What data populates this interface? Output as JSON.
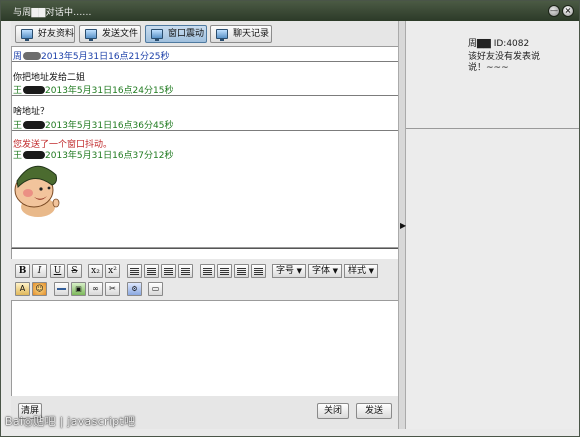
{
  "window": {
    "title": "与周▇▇对话中......",
    "minimize_glyph": "—",
    "close_glyph": "×"
  },
  "tabs": [
    {
      "label": "好友资料",
      "icon": "monitor-icon"
    },
    {
      "label": "发送文件",
      "icon": "monitor-icon"
    },
    {
      "label": "窗口震动",
      "icon": "monitor-icon",
      "active": true
    },
    {
      "label": "聊天记录",
      "icon": "monitor-icon"
    }
  ],
  "messages": [
    {
      "sender_prefix": "周",
      "timestamp": "2013年5月31日16点21分25秒",
      "text": "你把地址发给二姐"
    },
    {
      "sender_prefix": "王",
      "timestamp": "2013年5月31日16点24分15秒",
      "text": "啥地址？"
    },
    {
      "sender_prefix": "王",
      "timestamp": "2013年5月31日16点36分45秒",
      "text": "您发送了一个窗口抖动。"
    },
    {
      "sender_prefix": "王",
      "timestamp": "2013年5月31日16点37分12秒",
      "text": ""
    }
  ],
  "format_toolbar": {
    "bold": "B",
    "italic": "I",
    "underline": "U",
    "strike": "S",
    "subscript": "x₂",
    "superscript": "x²",
    "dropdowns": [
      "字号",
      "字体",
      "样式"
    ]
  },
  "buttons": {
    "clear": "清屏",
    "close": "关闭",
    "send": "发送"
  },
  "friend": {
    "name": "周▇▇",
    "id_text": "ID:4082",
    "status_note": "该好友没有发表说说！~~~"
  },
  "watermark": "Bai◎贴吧 | javascript吧",
  "colors": {
    "title_bg": "#3a4a35",
    "sender_blue": "#1a3ea8",
    "sender_green": "#1f7a1f",
    "shake_red": "#c0282a"
  }
}
